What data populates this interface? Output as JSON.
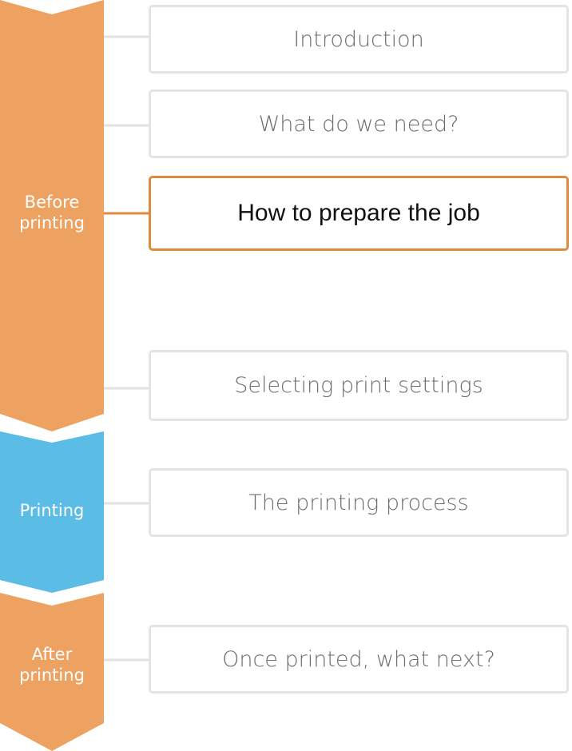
{
  "colors": {
    "before_printing": "#eda262",
    "printing": "#5bbce6",
    "after_printing": "#eda262",
    "connector_default": "#e2e2e2",
    "connector_active": "#e08a40",
    "step_border": "#e4e4e4",
    "step_border_active": "#e08a40"
  },
  "stages": {
    "before": {
      "label_line1": "Before",
      "label_line2": "printing"
    },
    "printing": {
      "label": "Printing"
    },
    "after": {
      "label_line1": "After",
      "label_line2": "printing"
    }
  },
  "steps": {
    "introduction": "Introduction",
    "what_do_we_need": "What do we need?",
    "prepare_job": "How to prepare the job",
    "print_settings": "Selecting print settings",
    "printing_process": "The printing process",
    "once_printed": "Once printed, what next?"
  },
  "active_step": "How to prepare the job"
}
